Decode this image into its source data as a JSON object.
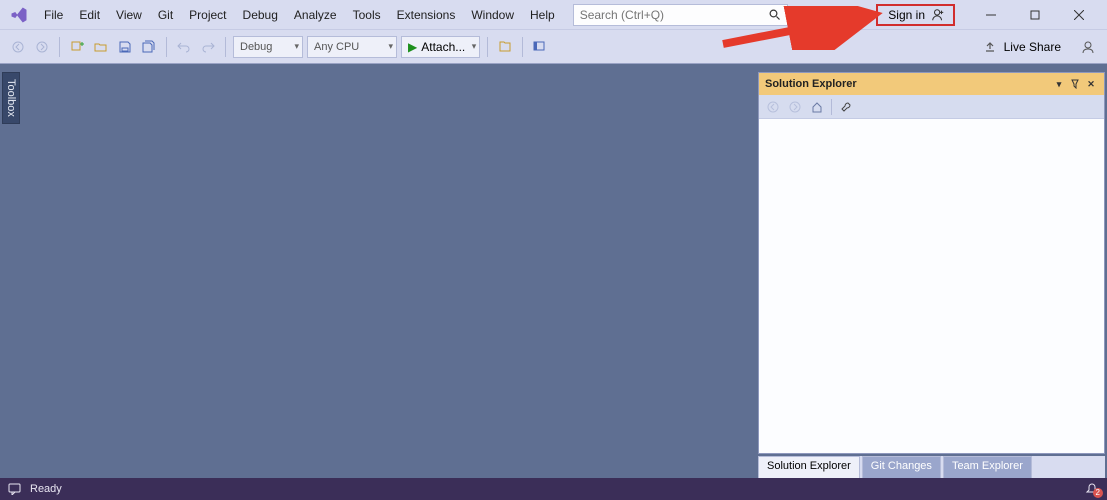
{
  "menu": {
    "items": [
      "File",
      "Edit",
      "View",
      "Git",
      "Project",
      "Debug",
      "Analyze",
      "Tools",
      "Extensions",
      "Window",
      "Help"
    ],
    "search_placeholder": "Search (Ctrl+Q)",
    "sign_in": "Sign in"
  },
  "toolbar": {
    "config": "Debug",
    "platform": "Any CPU",
    "attach": "Attach...",
    "live_share": "Live Share"
  },
  "toolbox": {
    "label": "Toolbox"
  },
  "solution_explorer": {
    "title": "Solution Explorer",
    "tabs": [
      "Solution Explorer",
      "Git Changes",
      "Team Explorer"
    ]
  },
  "status": {
    "ready": "Ready",
    "notifications": "2"
  }
}
